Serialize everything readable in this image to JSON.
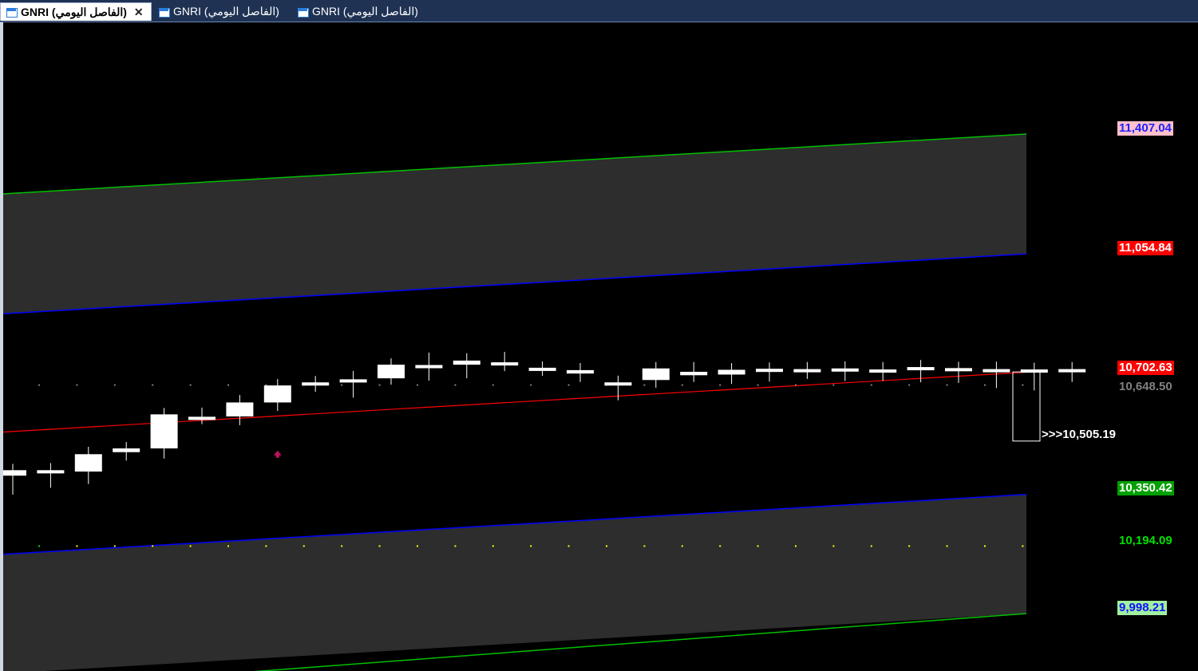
{
  "tabs": [
    {
      "label": "GNRI (الفاصل اليومي)",
      "active": true,
      "close_label": "✕"
    },
    {
      "label": "GNRI (الفاصل اليومي)",
      "active": false
    },
    {
      "label": "GNRI (الفاصل اليومي)",
      "active": false
    }
  ],
  "levels": {
    "upper_outer": {
      "value": 11407.04,
      "text": "11,407.04",
      "color": "#2020ff",
      "bg": "#ffc0cb"
    },
    "upper_inner": {
      "value": 11054.84,
      "text": "11,054.84",
      "color": "#ffffff",
      "bg": "#ff0000"
    },
    "middle": {
      "value": 10702.63,
      "text": "10,702.63",
      "color": "#ffffff",
      "bg": "#ff0000"
    },
    "prev_close": {
      "value": 10648.5,
      "text": "10,648.50",
      "color": "#808080",
      "bg": "#000000"
    },
    "last_price": {
      "value": 10505.19,
      "text": ">>>10,505.19"
    },
    "lower_inner": {
      "value": 10350.42,
      "text": "10,350.42",
      "color": "#ffffff",
      "bg": "#00a000"
    },
    "lower_dots": {
      "value": 10194.09,
      "text": "10,194.09",
      "color": "#00e000",
      "bg": "#000000"
    },
    "lower_outer": {
      "value": 9998.21,
      "text": "9,998.21",
      "color": "#1010ff",
      "bg": "#a0f0a0"
    }
  },
  "chart_data": {
    "type": "candlestick",
    "ylim": [
      9800,
      11850
    ],
    "series": [
      {
        "o": 10403,
        "h": 10403,
        "l": 10350,
        "c": 10387
      },
      {
        "o": 10403,
        "h": 10405,
        "l": 10370,
        "c": 10403
      },
      {
        "o": 10399,
        "h": 10453,
        "l": 10381,
        "c": 10450
      },
      {
        "o": 10456,
        "h": 10465,
        "l": 10450,
        "c": 10467
      },
      {
        "o": 10467,
        "h": 10560,
        "l": 10456,
        "c": 10567
      },
      {
        "o": 10557,
        "h": 10568,
        "l": 10560,
        "c": 10560
      },
      {
        "o": 10561,
        "h": 10605,
        "l": 10554,
        "c": 10602
      },
      {
        "o": 10602,
        "h": 10651,
        "l": 10596,
        "c": 10652
      },
      {
        "o": 10652,
        "h": 10656,
        "l": 10669,
        "c": 10661
      },
      {
        "o": 10661,
        "h": 10676,
        "l": 10635,
        "c": 10670
      },
      {
        "o": 10673,
        "h": 10713,
        "l": 10673,
        "c": 10713
      },
      {
        "o": 10708,
        "h": 10730,
        "l": 10685,
        "c": 10712
      },
      {
        "o": 10713,
        "h": 10728,
        "l": 10692,
        "c": 10725
      },
      {
        "o": 10715,
        "h": 10732,
        "l": 10713,
        "c": 10720
      },
      {
        "o": 10704,
        "h": 10701,
        "l": 10702,
        "c": 10699
      },
      {
        "o": 10697,
        "h": 10699,
        "l": 10681,
        "c": 10687
      },
      {
        "o": 10660,
        "h": 10662,
        "l": 10627,
        "c": 10661
      },
      {
        "o": 10668,
        "h": 10670,
        "l": 10664,
        "c": 10702
      },
      {
        "o": 10682,
        "h": 10702,
        "l": 10681,
        "c": 10692
      },
      {
        "o": 10684,
        "h": 10699,
        "l": 10675,
        "c": 10698
      },
      {
        "o": 10693,
        "h": 10701,
        "l": 10682,
        "c": 10701
      },
      {
        "o": 10697,
        "h": 10702,
        "l": 10690,
        "c": 10700
      },
      {
        "o": 10693,
        "h": 10704,
        "l": 10684,
        "c": 10702
      },
      {
        "o": 10696,
        "h": 10702,
        "l": 10684,
        "c": 10699
      },
      {
        "o": 10698,
        "h": 10708,
        "l": 10680,
        "c": 10706
      },
      {
        "o": 10703,
        "h": 10703,
        "l": 10678,
        "c": 10697
      },
      {
        "o": 10700,
        "h": 10703,
        "l": 10663,
        "c": 10696
      },
      {
        "o": 10699,
        "h": 10700,
        "l": 10656,
        "c": 10699
      },
      {
        "o": 10700,
        "h": 10702,
        "l": 10681,
        "c": 10700
      }
    ],
    "last_candle": {
      "o": 10680,
      "h": 10682,
      "l": 10505,
      "c": 10505,
      "hollow": true
    },
    "dotted_levels": [
      10648.5,
      10194.09
    ],
    "colors": {
      "band_fill": "#2d2d2d",
      "outer_line": "#00c000",
      "inner_line": "#0000ff",
      "mid_line": "#ff0000",
      "candle": "#ffffff",
      "dot_upper": "#808080",
      "dot_lower": "#ffff00",
      "signal": "#c01060"
    }
  }
}
